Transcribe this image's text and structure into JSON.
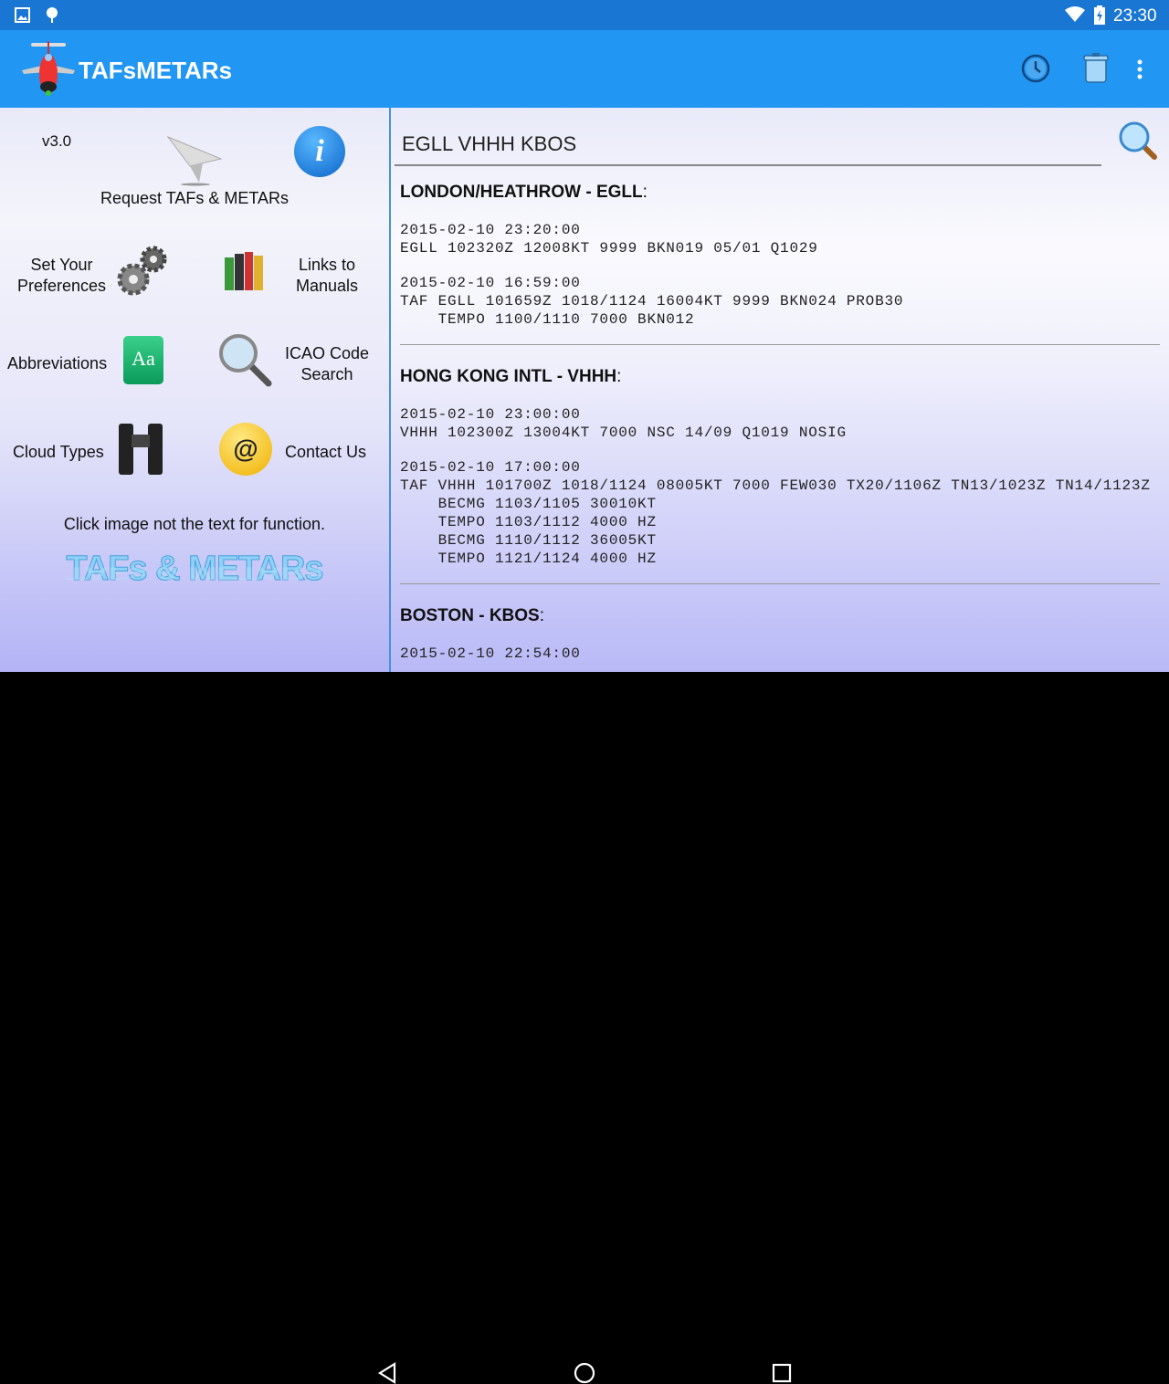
{
  "status_bar": {
    "time": "23:30",
    "icons": [
      "image-icon",
      "android-debug-icon",
      "wifi-icon",
      "battery-charging-icon"
    ]
  },
  "app_bar": {
    "title": "TAFsMETARs",
    "actions": [
      "history-icon",
      "trash-icon",
      "overflow-menu-icon"
    ]
  },
  "left_panel": {
    "version": "v3.0",
    "request_label": "Request TAFs & METARs",
    "items": [
      {
        "label": "Set Your Preferences",
        "icon": "gears-icon"
      },
      {
        "label": "Links to Manuals",
        "icon": "books-icon"
      },
      {
        "label": "Abbreviations",
        "icon": "dictionary-icon",
        "icon_text": "Aa"
      },
      {
        "label": "ICAO Code Search",
        "icon": "magnifier-icon"
      },
      {
        "label": "Cloud Types",
        "icon": "binoculars-icon"
      },
      {
        "label": "Contact Us",
        "icon": "at-sign-icon",
        "icon_text": "@"
      }
    ],
    "hint": "Click image not the text for function.",
    "logo_text": "TAFs & METARs"
  },
  "search": {
    "value": "EGLL VHHH KBOS"
  },
  "stations": [
    {
      "name": "LONDON/HEATHROW - EGLL",
      "reports": [
        {
          "time": "2015-02-10 23:20:00",
          "text": "EGLL 102320Z 12008KT 9999 BKN019 05/01 Q1029"
        },
        {
          "time": "2015-02-10 16:59:00",
          "text": "TAF EGLL 101659Z 1018/1124 16004KT 9999 BKN024 PROB30\n    TEMPO 1100/1110 7000 BKN012"
        }
      ]
    },
    {
      "name": "HONG KONG INTL - VHHH",
      "reports": [
        {
          "time": "2015-02-10 23:00:00",
          "text": "VHHH 102300Z 13004KT 7000 NSC 14/09 Q1019 NOSIG"
        },
        {
          "time": "2015-02-10 17:00:00",
          "text": "TAF VHHH 101700Z 1018/1124 08005KT 7000 FEW030 TX20/1106Z TN13/1023Z TN14/1123Z\n    BECMG 1103/1105 30010KT\n    TEMPO 1103/1112 4000 HZ\n    BECMG 1110/1112 36005KT\n    TEMPO 1121/1124 4000 HZ"
        }
      ]
    },
    {
      "name": "BOSTON - KBOS",
      "reports": [
        {
          "time": "2015-02-10 22:54:00",
          "text": ""
        }
      ]
    }
  ],
  "colors": {
    "status_bar": "#1976D2",
    "app_bar": "#2196F3"
  }
}
